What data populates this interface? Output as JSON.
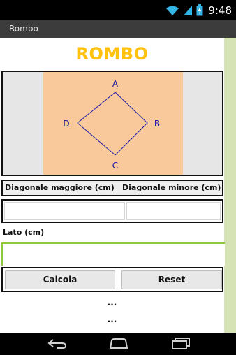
{
  "status_bar": {
    "time": "9:48",
    "icons": [
      "wifi-icon",
      "signal-icon",
      "battery-icon"
    ]
  },
  "window": {
    "title": "Rombo"
  },
  "app": {
    "heading": "ROMBO",
    "diagram": {
      "vertex_labels": {
        "top": "A",
        "right": "B",
        "bottom": "C",
        "left": "D"
      }
    },
    "fields": {
      "major_diagonal_label": "Diagonale maggiore (cm)",
      "minor_diagonal_label": "Diagonale minore (cm)",
      "major_diagonal_value": "",
      "minor_diagonal_value": "",
      "side_label": "Lato (cm)",
      "side_value": ""
    },
    "buttons": {
      "calculate": "Calcola",
      "reset": "Reset"
    },
    "results": {
      "line1": "...",
      "line2": "..."
    }
  },
  "nav_bar": {
    "icons": [
      "back-icon",
      "home-icon",
      "recent-apps-icon"
    ]
  },
  "colors": {
    "title_accent": "#ffc20e",
    "diagram_fill": "#f9c89b",
    "diagram_stroke": "#1a1aa6",
    "input_focus": "#8dc63f",
    "side_strip": "#d6e3b5"
  }
}
